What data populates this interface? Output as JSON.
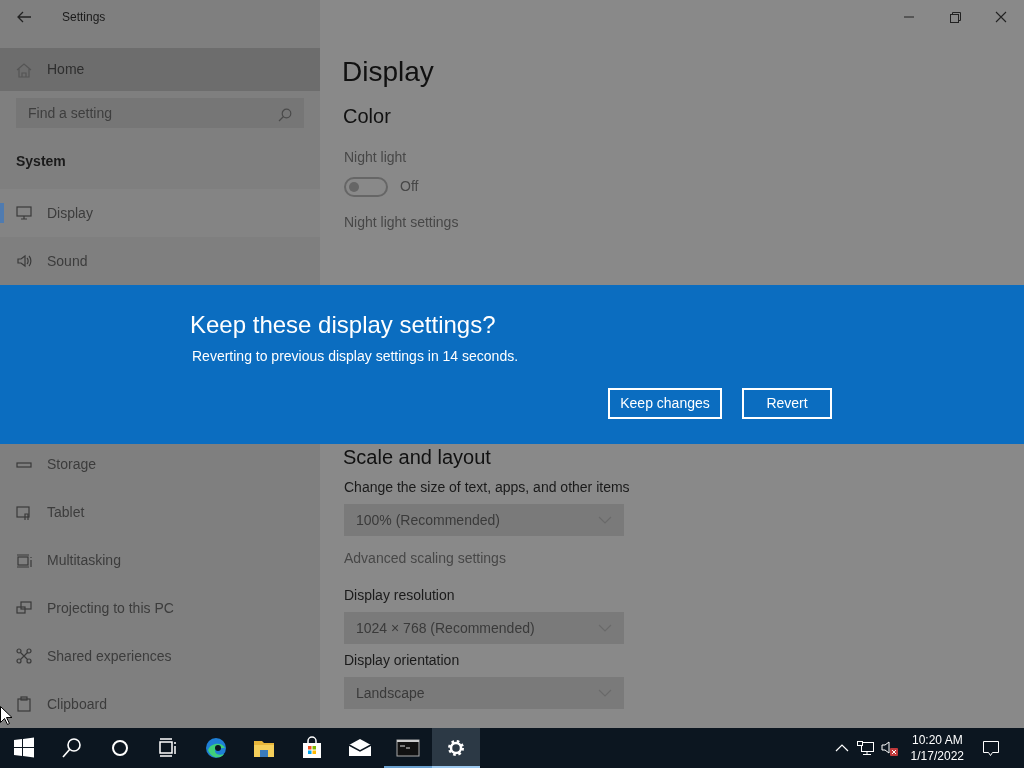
{
  "window": {
    "title": "Settings"
  },
  "sidebar": {
    "home": "Home",
    "search": {
      "placeholder": "Find a setting"
    },
    "section": "System",
    "items_above_dialog": [
      {
        "label": "Display",
        "selected": true
      },
      {
        "label": "Sound",
        "selected": false
      }
    ],
    "items_below_dialog": [
      {
        "label": "Storage",
        "selected": false
      },
      {
        "label": "Tablet",
        "selected": false
      },
      {
        "label": "Multitasking",
        "selected": false
      },
      {
        "label": "Projecting to this PC",
        "selected": false
      },
      {
        "label": "Shared experiences",
        "selected": false
      },
      {
        "label": "Clipboard",
        "selected": false
      }
    ]
  },
  "content": {
    "title": "Display",
    "color_section": {
      "heading": "Color",
      "night_light": {
        "label": "Night light",
        "on": false,
        "state_label": "Off"
      },
      "link": "Night light settings"
    },
    "scale_section": {
      "heading": "Scale and layout",
      "items": [
        {
          "kind": "label",
          "text": "Change the size of text, apps, and other items"
        },
        {
          "kind": "dropdown",
          "text": "100% (Recommended)"
        },
        {
          "kind": "link",
          "text": "Advanced scaling settings"
        },
        {
          "kind": "label",
          "text": "Display resolution"
        },
        {
          "kind": "dropdown",
          "text": "1024 × 768 (Recommended)"
        },
        {
          "kind": "label",
          "text": "Display orientation"
        },
        {
          "kind": "dropdown",
          "text": "Landscape"
        }
      ]
    }
  },
  "dialog": {
    "title": "Keep these display settings?",
    "message": "Reverting to previous display settings in 14 seconds.",
    "buttons": [
      {
        "label": "Keep changes"
      },
      {
        "label": "Revert"
      }
    ]
  },
  "taskbar": {
    "apps": [
      {
        "kind": "browser",
        "running": false,
        "selected": false
      },
      {
        "kind": "folder",
        "running": false,
        "selected": false
      },
      {
        "kind": "store",
        "running": false,
        "selected": false
      },
      {
        "kind": "mail",
        "running": false,
        "selected": false
      },
      {
        "kind": "terminal",
        "running": true,
        "selected": false
      },
      {
        "kind": "settings",
        "running": true,
        "selected": true
      }
    ],
    "time": "10:20 AM",
    "date": "1/17/2022"
  }
}
